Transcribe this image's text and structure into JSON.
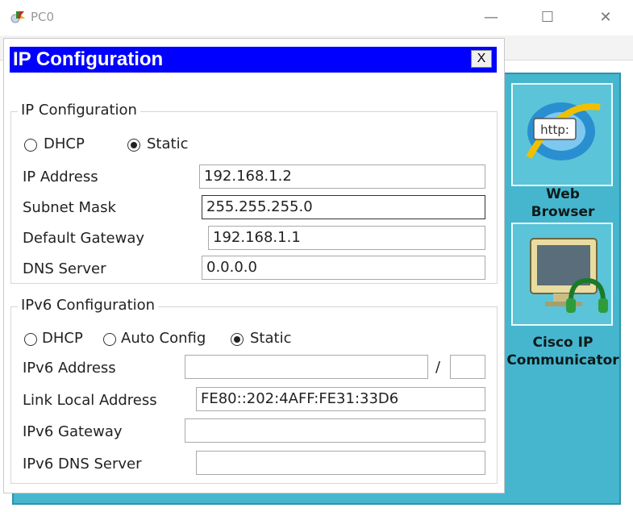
{
  "window": {
    "title": "PC0",
    "minimize_glyph": "—",
    "maximize_glyph": "☐",
    "close_glyph": "✕"
  },
  "desktop": {
    "icons": [
      {
        "label_line1": "Web",
        "label_line2": "Browser",
        "icon": "web-browser-icon",
        "badge": "http:"
      },
      {
        "label_line1": "Cisco IP",
        "label_line2": "Communicator",
        "icon": "cisco-ip-communicator-icon"
      }
    ]
  },
  "dialog": {
    "title": "IP Configuration",
    "close_label": "X",
    "ipv4": {
      "legend": "IP Configuration",
      "dhcp_label": "DHCP",
      "static_label": "Static",
      "mode": "Static",
      "ip_address_label": "IP Address",
      "ip_address": "192.168.1.2",
      "subnet_mask_label": "Subnet Mask",
      "subnet_mask": "255.255.255.0",
      "gateway_label": "Default Gateway",
      "gateway": "192.168.1.1",
      "dns_label": "DNS Server",
      "dns": "0.0.0.0"
    },
    "ipv6": {
      "legend": "IPv6 Configuration",
      "dhcp_label": "DHCP",
      "auto_label": "Auto Config",
      "static_label": "Static",
      "mode": "Static",
      "address_label": "IPv6 Address",
      "address": "",
      "prefix_separator": "/",
      "prefix": "",
      "link_local_label": "Link Local Address",
      "link_local": "FE80::202:4AFF:FE31:33D6",
      "gateway_label": "IPv6 Gateway",
      "gateway": "",
      "dns_label": "IPv6 DNS Server",
      "dns": ""
    }
  }
}
